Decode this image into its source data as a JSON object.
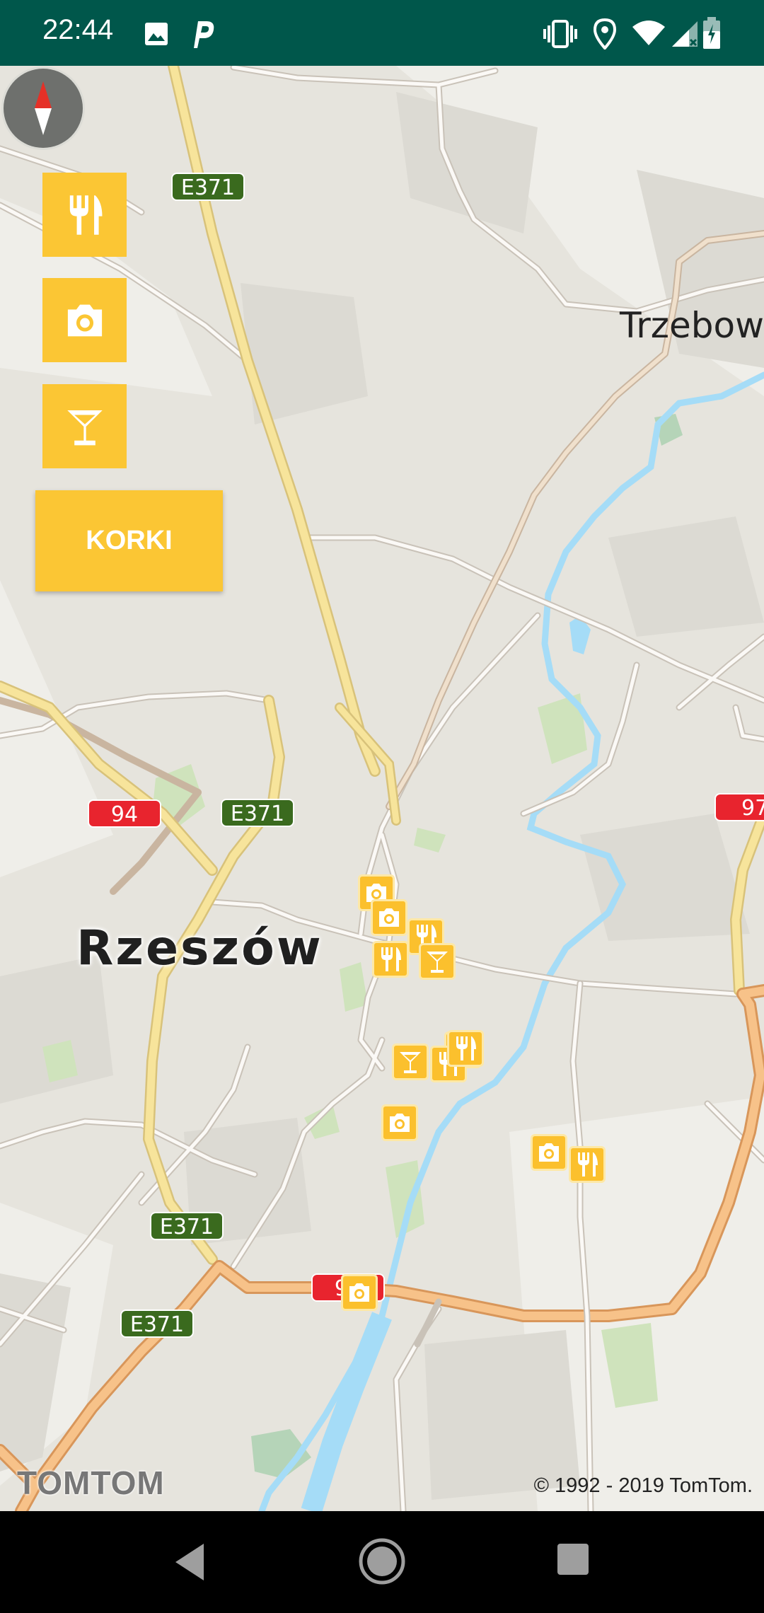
{
  "status_bar": {
    "time": "22:44",
    "icons": [
      "image-icon",
      "parking-app-icon",
      "vibrate-icon",
      "location-icon",
      "wifi-icon",
      "signal-icon",
      "battery-icon"
    ]
  },
  "map": {
    "city_label": "Rzeszów",
    "place_labels": [
      "Trzebown"
    ],
    "road_shields": {
      "e371_1": "E371",
      "e371_2": "E371",
      "e371_3": "E371",
      "e371_4": "E371",
      "r94_1": "94",
      "r94_2": "94",
      "r97": "97"
    },
    "poi_types": [
      "restaurant-icon",
      "camera-icon",
      "cocktail-icon"
    ]
  },
  "controls": {
    "korki_label": "KORKI",
    "filter_buttons": [
      "restaurant-filter",
      "sightseeing-filter",
      "bar-filter"
    ]
  },
  "branding": {
    "logo": "TOMTOM",
    "copyright": "© 1992 - 2019 TomTom."
  },
  "colors": {
    "status_bar": "#00574b",
    "accent_yellow": "#fbc634",
    "poi_yellow": "#fbc02d",
    "shield_green": "#3a6a1e",
    "shield_red": "#e8242e",
    "river": "#a5dcf7",
    "major_road": "#f7c289",
    "highway_yellow": "#f7e49b"
  }
}
